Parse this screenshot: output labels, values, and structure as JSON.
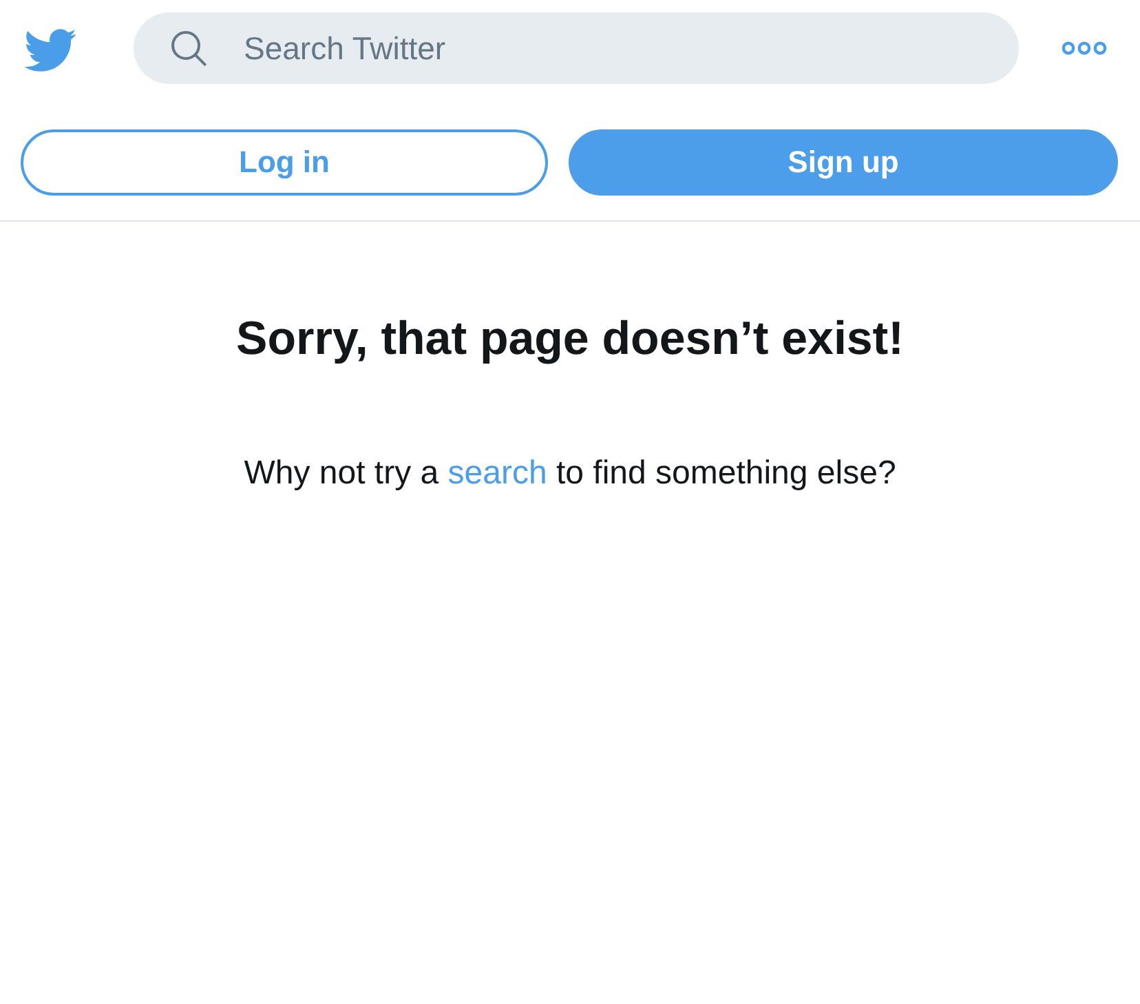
{
  "header": {
    "search": {
      "placeholder": "Search Twitter"
    }
  },
  "buttons": [
    {
      "label": "Log in",
      "kind": "outline"
    },
    {
      "label": "Sign up",
      "kind": "filled"
    }
  ],
  "error": {
    "title": "Sorry, that page doesn’t exist!",
    "message": {
      "before": "Why not try a ",
      "link": "search",
      "after": " to find something else?"
    }
  }
}
